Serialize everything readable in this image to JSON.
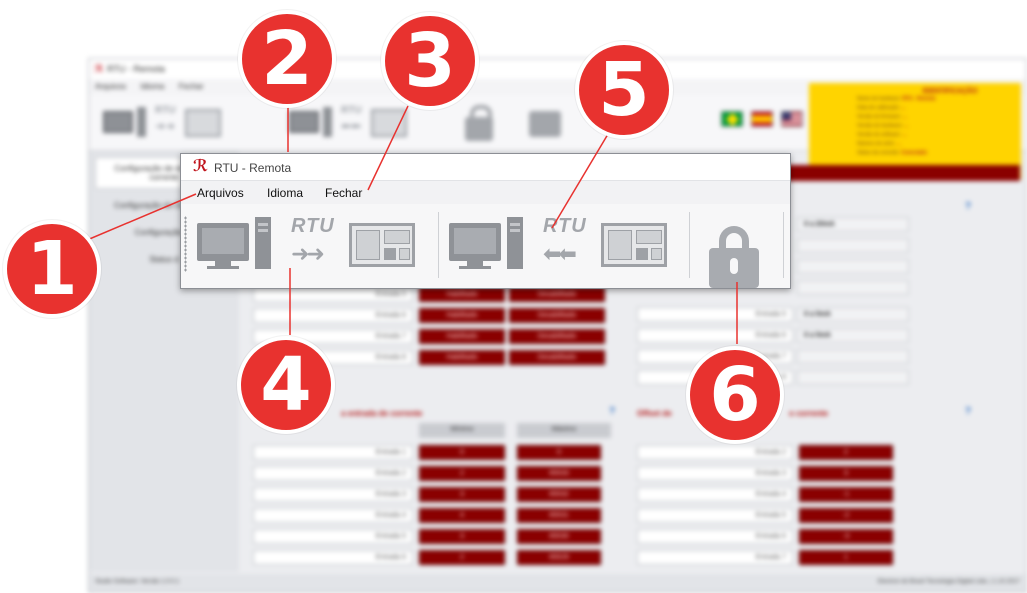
{
  "background_window": {
    "title": "RTU - Remota",
    "menu": [
      "Arquivos",
      "Idioma",
      "Fechar"
    ],
    "sidebar": [
      "Configuração de entrada de corrente",
      "Configuração do Datalogger",
      "Configuração de",
      "Status d"
    ],
    "identification": {
      "title": "IDENTIFICAÇÃO",
      "rows": [
        {
          "label": "Nome do hardware:",
          "value": "RTU - Remota"
        },
        {
          "label": "Data de calibração:",
          "value": "..."
        },
        {
          "label": "Versão do firmware:",
          "value": "..."
        },
        {
          "label": "Versão do hardware:",
          "value": "..."
        },
        {
          "label": "Versão do software:",
          "value": "..."
        },
        {
          "label": "Número de série:",
          "value": "..."
        },
        {
          "label": "Status da conexão:",
          "value": "Conectado"
        }
      ]
    },
    "inputs_top": [
      "Entrada 5",
      "Entrada 6",
      "Entrada 7",
      "Entrada 8"
    ],
    "enable_label": "Habilitado",
    "disable_label": "Desabilitado",
    "range_options": [
      "0 a 20mA",
      "0 a 5mA",
      "0 a 5mA"
    ],
    "section_current_title": "a entrada de corrente",
    "section_offset_title": "Offset de",
    "section_offset_title_end": "o corrente",
    "col_min": "Mínimo",
    "col_max": "Máximo",
    "min_rows": [
      {
        "label": "Entrada 1",
        "min": "0",
        "max": "0"
      },
      {
        "label": "Entrada 2",
        "min": "2",
        "max": "65533"
      },
      {
        "label": "Entrada 3",
        "min": "3",
        "max": "65532"
      },
      {
        "label": "Entrada 4",
        "min": "4",
        "max": "65531"
      },
      {
        "label": "Entrada 5",
        "min": "3",
        "max": "65530"
      },
      {
        "label": "Entrada 6",
        "min": "2",
        "max": "65529"
      }
    ],
    "offset_rows": [
      {
        "label": "Entrada 2",
        "value": "2"
      },
      {
        "label": "Entrada 3",
        "value": "3"
      },
      {
        "label": "Entrada 4",
        "value": "-1"
      },
      {
        "label": "Entrada 5",
        "value": "-2"
      },
      {
        "label": "Entrada 6",
        "value": "-3"
      },
      {
        "label": "Entrada 7",
        "value": "1"
      }
    ],
    "status_left": "Studio Software: Versão 1.0.0.1",
    "status_right": "Electron do Brasil Tecnologia Digital Ltda. | 1.10.2017"
  },
  "front_window": {
    "title": "RTU - Remota",
    "menu": {
      "arquivos": "Arquivos",
      "idioma": "Idioma",
      "fechar": "Fechar"
    },
    "toolbar": {
      "rtu_send": "RTU",
      "rtu_receive": "RTU"
    }
  },
  "callouts": [
    "1",
    "2",
    "3",
    "4",
    "5",
    "6"
  ],
  "colors": {
    "callout": "#e8322f",
    "accent_red": "#8a0000",
    "ident_yellow": "#ffd400"
  }
}
